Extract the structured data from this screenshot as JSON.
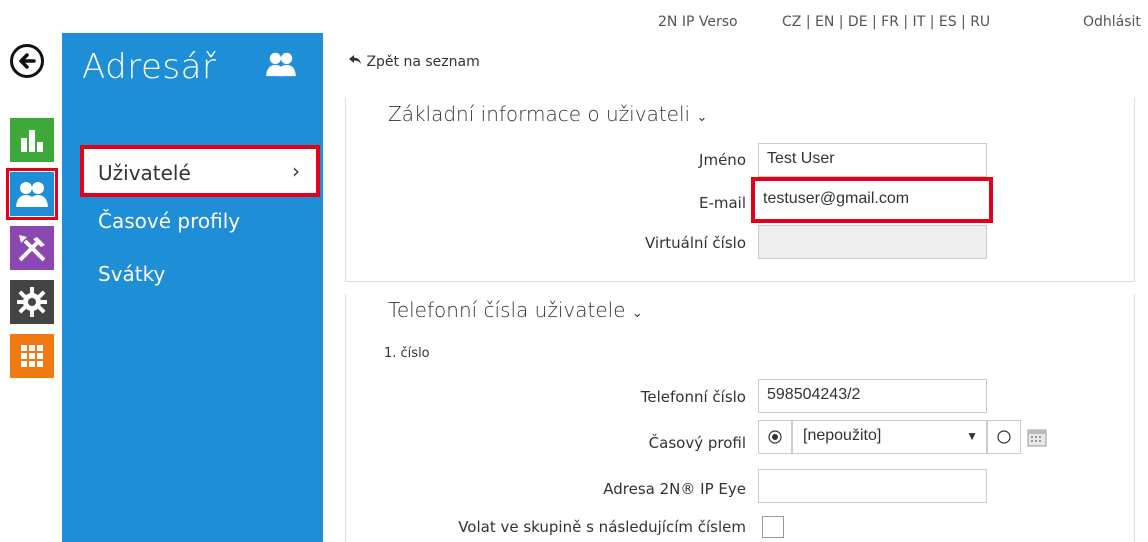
{
  "top": {
    "product": "2N IP Verso",
    "languages": "CZ | EN | DE | FR | IT | ES | RU",
    "logout": "Odhlásit"
  },
  "rail": {
    "icons": [
      "back-icon",
      "statistics-icon",
      "users-icon",
      "tools-icon",
      "settings-icon",
      "grid-icon"
    ],
    "colors": {
      "stats": "#3ea83a",
      "users": "#1e8fd6",
      "tools": "#8b48b2",
      "gear": "#444444",
      "grid": "#f07a11"
    }
  },
  "nav": {
    "title": "Adresář",
    "items": [
      {
        "label": "Uživatelé",
        "chevron": "›"
      },
      {
        "label": "Časové profily"
      },
      {
        "label": "Svátky"
      }
    ]
  },
  "content": {
    "back_link": "Zpět na seznam",
    "basic": {
      "title": "Základní informace o uživateli",
      "name_label": "Jméno",
      "name_value": "Test User",
      "email_label": "E-mail",
      "email_value": "testuser@gmail.com",
      "virtual_label": "Virtuální číslo",
      "virtual_value": ""
    },
    "phones": {
      "title": "Telefonní čísla uživatele",
      "subtitle": "1. číslo",
      "phone_label": "Telefonní číslo",
      "phone_value": "598504243/2",
      "profile_label": "Časový profil",
      "profile_value": "[nepoužito]",
      "eye_label": "Adresa 2N® IP Eye",
      "eye_value": "",
      "group_label": "Volat ve skupině s následujícím číslem"
    }
  }
}
